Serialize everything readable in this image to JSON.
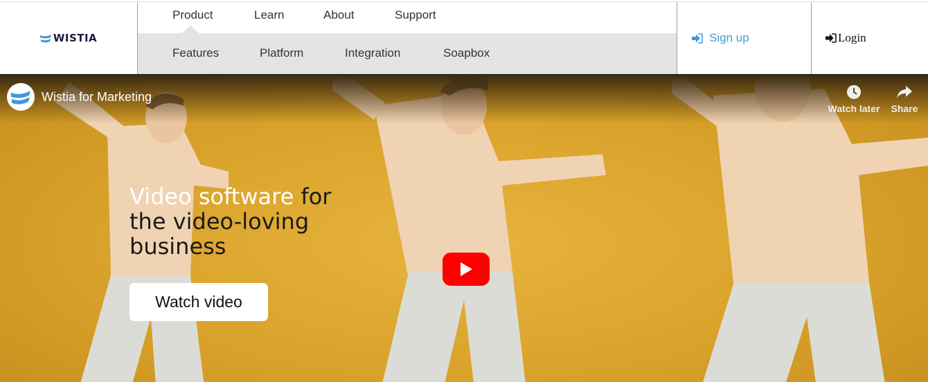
{
  "brand": {
    "name": "WISTIA",
    "accent": "#3f9ad9"
  },
  "nav": {
    "top_items": [
      "Product",
      "Learn",
      "About",
      "Support"
    ],
    "sub_items": [
      "Features",
      "Platform",
      "Integration",
      "Soapbox"
    ]
  },
  "account": {
    "signup_label": "Sign up",
    "login_label": "Login"
  },
  "video": {
    "title": "Wistia for Marketing",
    "watch_later_label": "Watch later",
    "share_label": "Share"
  },
  "hero": {
    "headline_highlight": "Video software",
    "headline_rest": " for the video-loving business",
    "cta_label": "Watch video"
  },
  "icons": {
    "logo": "wistia-logo-icon",
    "signup": "sign-in-arrow-icon",
    "login": "login-arrow-icon",
    "watch_later": "clock-icon",
    "share": "share-arrow-icon",
    "play": "play-icon"
  }
}
